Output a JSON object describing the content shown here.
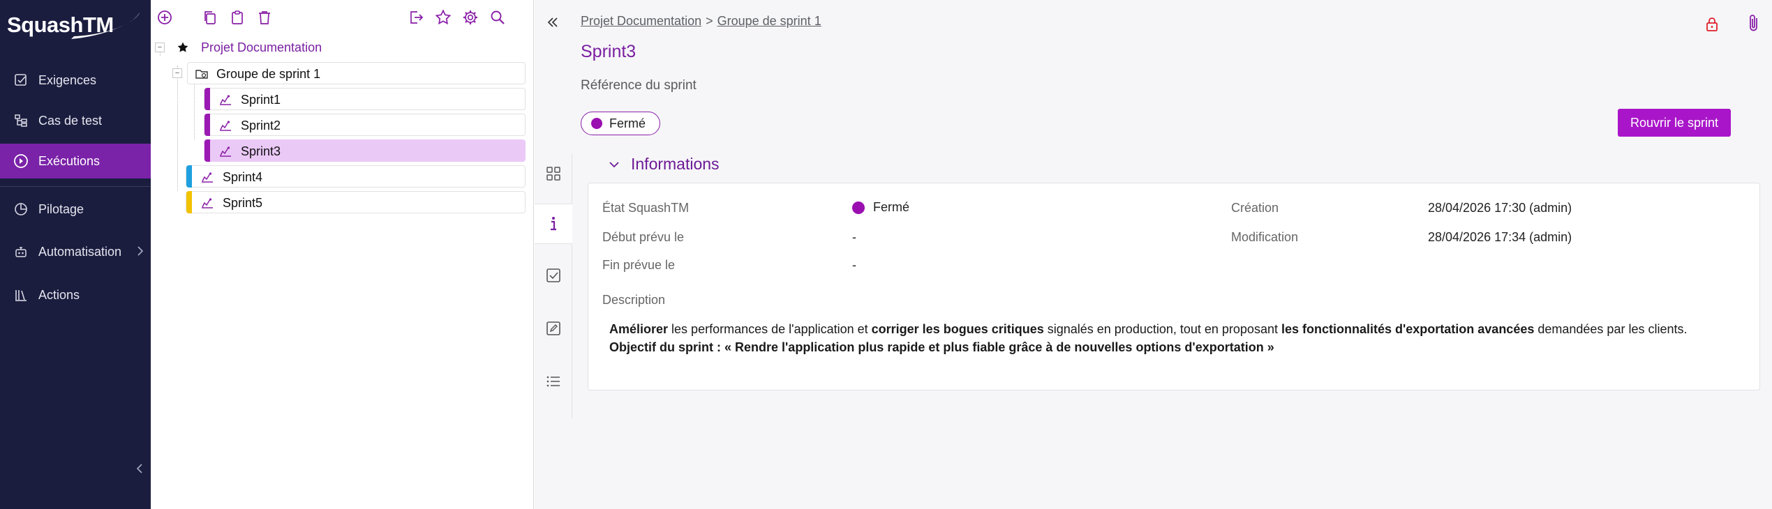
{
  "app": {
    "logo": "SquashTM"
  },
  "nav": {
    "items": [
      {
        "label": "Exigences",
        "icon": "check-square-icon",
        "active": false
      },
      {
        "label": "Cas de test",
        "icon": "hierarchy-icon",
        "active": false
      },
      {
        "label": "Exécutions",
        "icon": "play-circle-icon",
        "active": true
      },
      {
        "label": "Pilotage",
        "icon": "pie-chart-icon",
        "active": false
      },
      {
        "label": "Automatisation",
        "icon": "robot-icon",
        "active": false
      },
      {
        "label": "Actions",
        "icon": "library-icon",
        "active": false
      }
    ]
  },
  "tree": {
    "project": "Projet Documentation",
    "group": "Groupe de sprint 1",
    "sprints_in_group": [
      "Sprint1",
      "Sprint2",
      "Sprint3"
    ],
    "sprints_root": [
      "Sprint4",
      "Sprint5"
    ],
    "selected": "Sprint3",
    "colors": {
      "closed": "#9b19b3",
      "in_progress": "#1fa0e0",
      "upcoming": "#f2c300"
    }
  },
  "main": {
    "breadcrumb": {
      "project": "Projet Documentation",
      "separator": ">",
      "group": "Groupe de sprint 1"
    },
    "title": "Sprint3",
    "reference_label": "Référence du sprint",
    "status": "Fermé",
    "reopen_label": "Rouvrir le sprint",
    "section_title": "Informations",
    "fields": {
      "etat_label": "État SquashTM",
      "etat_value": "Fermé",
      "debut_label": "Début prévu le",
      "debut_value": "-",
      "fin_label": "Fin prévue le",
      "fin_value": "-",
      "creation_label": "Création",
      "creation_value": "28/04/2026 17:30 (admin)",
      "modification_label": "Modification",
      "modification_value": "28/04/2026 17:34 (admin)",
      "description_label": "Description"
    },
    "description": {
      "l1_b1": "Améliorer",
      "l1_t1": " les performances de l'application et ",
      "l1_b2": "corriger les bogues critiques",
      "l1_t2": " signalés en production, tout en proposant ",
      "l1_b3": "les fonctionnalités d'exportation avancées",
      "l1_t3": " demandées par les clients.",
      "l2": "Objectif du sprint : « Rendre l'application plus rapide et plus fiable grâce à de nouvelles options d'exportation »"
    },
    "accent_color": "#7a1fa2"
  }
}
